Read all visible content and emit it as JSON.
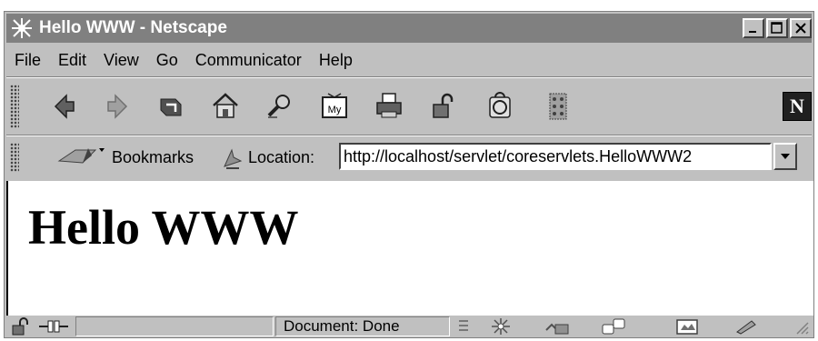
{
  "window": {
    "title": "Hello WWW - Netscape",
    "controls": [
      "minimize",
      "maximize",
      "close"
    ]
  },
  "menu": {
    "items": [
      {
        "label": "File"
      },
      {
        "label": "Edit"
      },
      {
        "label": "View"
      },
      {
        "label": "Go"
      },
      {
        "label": "Communicator"
      },
      {
        "label": "Help"
      }
    ]
  },
  "toolbar": {
    "buttons": [
      "back-icon",
      "forward-icon",
      "reload-icon",
      "home-icon",
      "search-icon",
      "my-netscape-icon",
      "print-icon",
      "security-icon",
      "shop-icon",
      "stop-icon"
    ],
    "logo_letter": "N"
  },
  "location": {
    "bookmarks_label": "Bookmarks",
    "location_label": "Location:",
    "url": "http://localhost/servlet/coreservlets.HelloWWW2"
  },
  "page": {
    "heading": "Hello WWW"
  },
  "status": {
    "text": "Document: Done"
  },
  "colors": {
    "chrome": "#c0c0c0",
    "titlebar": "#808080",
    "content_bg": "#ffffff"
  }
}
